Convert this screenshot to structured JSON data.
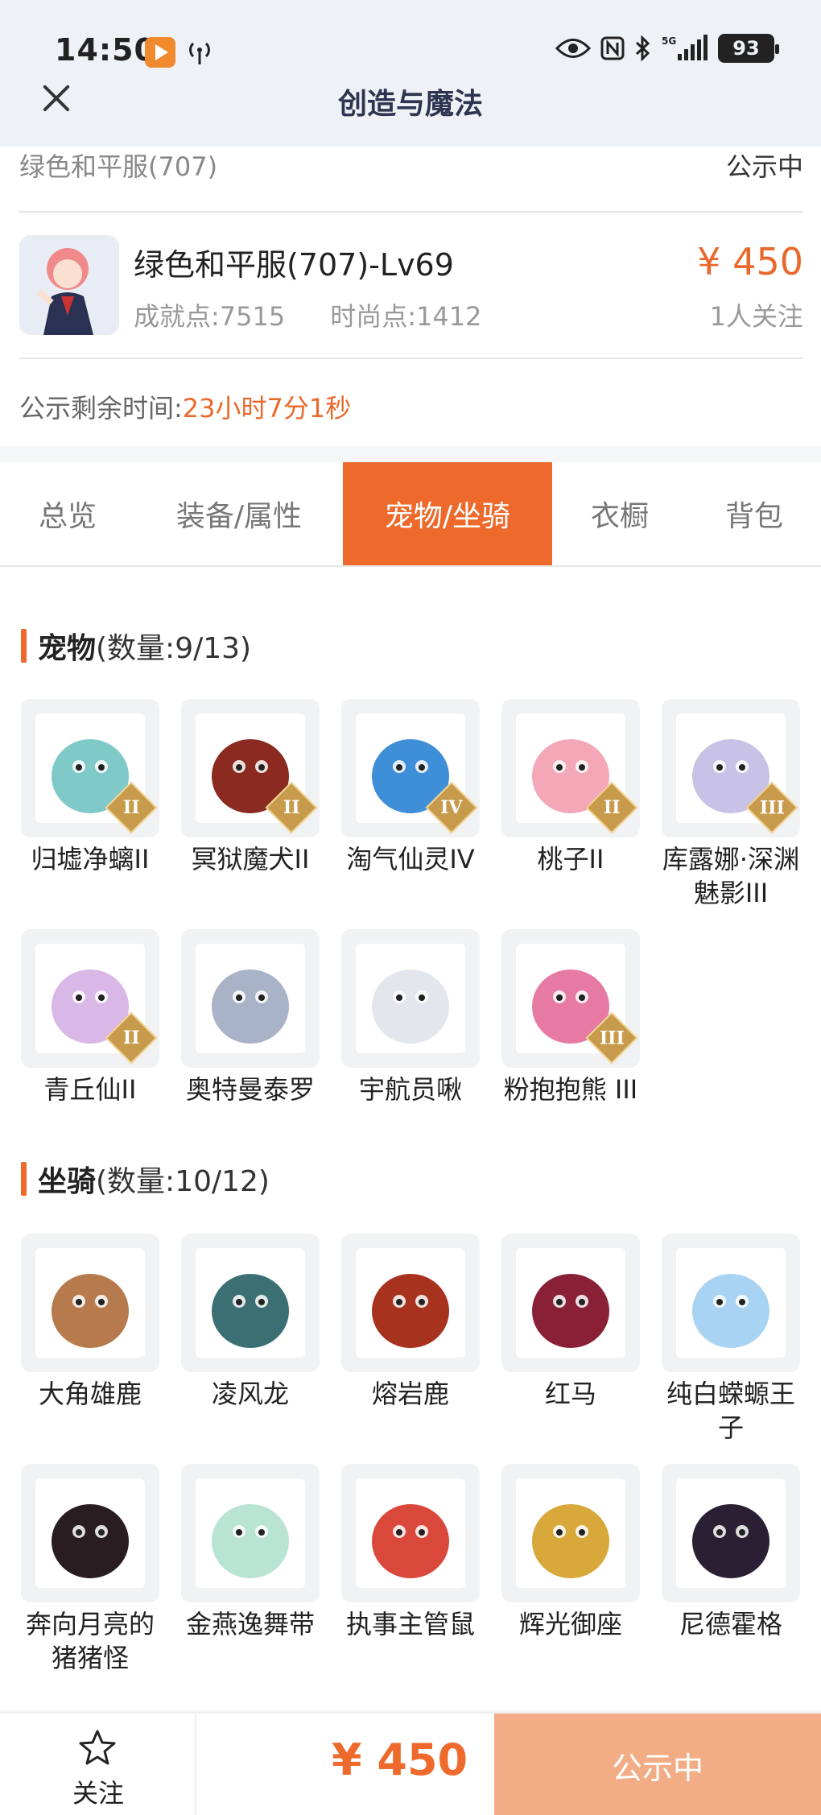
{
  "status_bar": {
    "time": "14:50",
    "battery": "93",
    "network": "5G"
  },
  "header": {
    "title": "创造与魔法"
  },
  "info": {
    "name_top": "绿色和平服(707)",
    "status_top": "公示中",
    "role_name": "绿色和平服(707)-Lv69",
    "achievement": "成就点:7515",
    "fashion": "时尚点:1412",
    "price": "¥ 450",
    "watchers": "1人关注",
    "remain_label": "公示剩余时间:",
    "remain_value": "23小时7分1秒"
  },
  "tabs": [
    {
      "label": "总览",
      "active": false
    },
    {
      "label": "装备/属性",
      "active": false
    },
    {
      "label": "宠物/坐骑",
      "active": true
    },
    {
      "label": "衣橱",
      "active": false
    },
    {
      "label": "背包",
      "active": false
    }
  ],
  "pets": {
    "title": "宠物",
    "count": "(数量:9/13)",
    "items": [
      {
        "name": "归墟净螭II",
        "grade": "II",
        "color": "#7fc9c8"
      },
      {
        "name": "冥狱魔犬II",
        "grade": "II",
        "color": "#8a2a20"
      },
      {
        "name": "淘气仙灵IV",
        "grade": "IV",
        "color": "#3e8ed8"
      },
      {
        "name": "桃子II",
        "grade": "II",
        "color": "#f4a7b6"
      },
      {
        "name": "库露娜·深渊魅影III",
        "grade": "III",
        "color": "#c8c3e6"
      },
      {
        "name": "青丘仙II",
        "grade": "II",
        "color": "#d9b7e6"
      },
      {
        "name": "奥特曼泰罗",
        "grade": "",
        "color": "#a9b3c8"
      },
      {
        "name": "宇航员啾",
        "grade": "",
        "color": "#e4e6ee"
      },
      {
        "name": "粉抱抱熊 III",
        "grade": "III",
        "color": "#e77aa3"
      }
    ]
  },
  "mounts": {
    "title": "坐骑",
    "count": "(数量:10/12)",
    "items": [
      {
        "name": "大角雄鹿",
        "color": "#b77a4c"
      },
      {
        "name": "凌风龙",
        "color": "#3c6f73"
      },
      {
        "name": "熔岩鹿",
        "color": "#a7321e"
      },
      {
        "name": "红马",
        "color": "#8a2035"
      },
      {
        "name": "纯白蝾螈王子",
        "color": "#a9d3f2"
      },
      {
        "name": "奔向月亮的猪猪怪",
        "color": "#2a1d22"
      },
      {
        "name": "金燕逸舞带",
        "color": "#b9e3d2"
      },
      {
        "name": "执事主管鼠",
        "color": "#d9483a"
      },
      {
        "name": "辉光御座",
        "color": "#d9a83a"
      },
      {
        "name": "尼德霍格",
        "color": "#2a1f33"
      }
    ]
  },
  "bottom": {
    "follow_label": "关注",
    "price": "¥ 450",
    "action": "公示中"
  },
  "colors": {
    "accent": "#ee6a2c",
    "action_bg": "#f2ad86",
    "badge": "#c89b4c"
  }
}
